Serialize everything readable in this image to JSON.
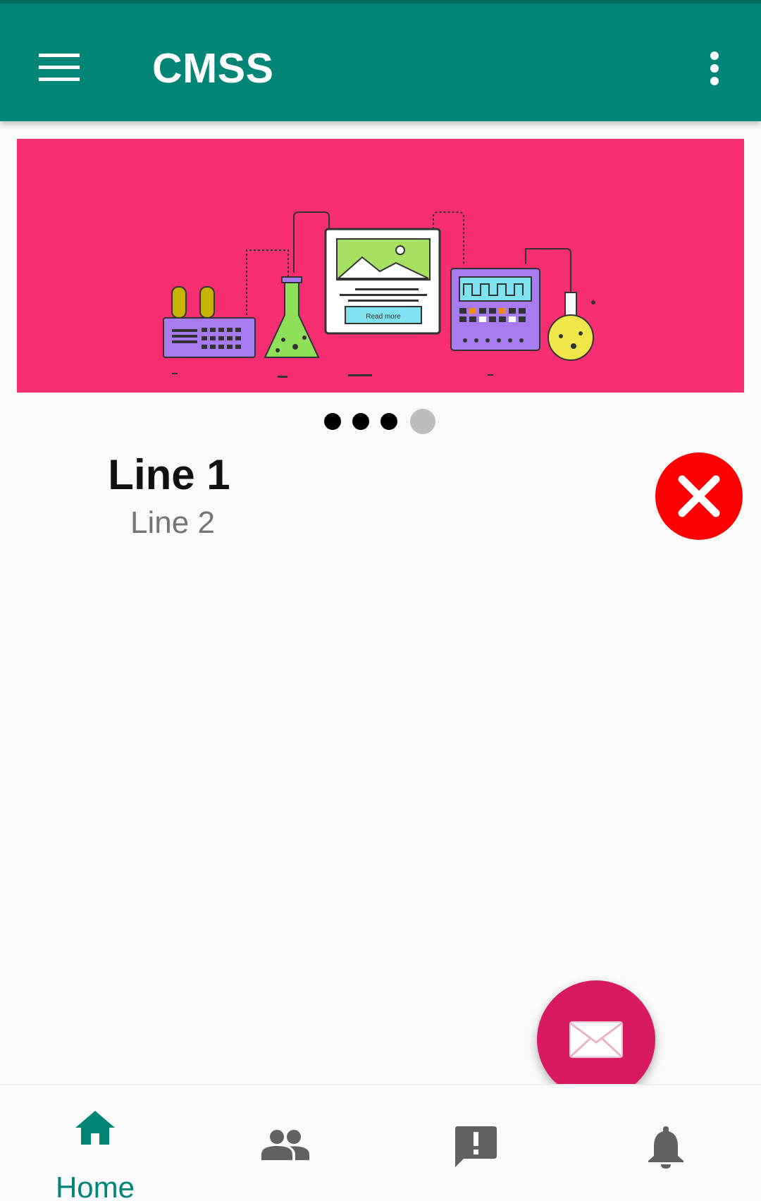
{
  "app_bar": {
    "title": "CMSS",
    "menu_icon": "hamburger-menu-icon",
    "overflow_icon": "more-vert-icon",
    "color": "#008577"
  },
  "banner": {
    "background": "#f72e71",
    "illustration": "lab-equipment-illustration",
    "button_text": "Read more",
    "page_indicator": {
      "count": 4,
      "active_index": 3
    }
  },
  "content": {
    "line1": "Line 1",
    "line2": "Line 2",
    "close_icon": "close-icon"
  },
  "fab": {
    "icon": "mail-icon",
    "color": "#d81b60"
  },
  "bottom_nav": {
    "items": [
      {
        "icon": "home-icon",
        "label": "Home",
        "active": true
      },
      {
        "icon": "people-icon",
        "label": "",
        "active": false
      },
      {
        "icon": "feedback-icon",
        "label": "",
        "active": false
      },
      {
        "icon": "notifications-icon",
        "label": "",
        "active": false
      }
    ],
    "active_color": "#008577",
    "inactive_color": "#616161"
  }
}
